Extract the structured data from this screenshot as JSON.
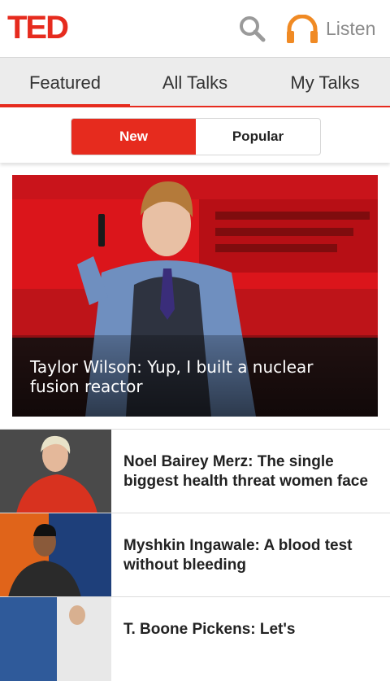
{
  "app": {
    "logo_text": "TED",
    "brand_color": "#e62b1e"
  },
  "header": {
    "search_icon": "search-icon",
    "listen_icon": "headphones-icon",
    "listen_label": "Listen"
  },
  "tabs": [
    {
      "label": "Featured",
      "active": true
    },
    {
      "label": "All Talks",
      "active": false
    },
    {
      "label": "My Talks",
      "active": false
    }
  ],
  "segmented": {
    "new_label": "New",
    "popular_label": "Popular",
    "selected": "New"
  },
  "hero": {
    "caption": "Taylor Wilson: Yup, I built a nuclear fusion reactor"
  },
  "talks": [
    {
      "title": "Noel Bairey Merz: The single biggest health threat women face"
    },
    {
      "title": "Myshkin Ingawale: A blood test without bleeding"
    },
    {
      "title": "T. Boone Pickens: Let's"
    }
  ]
}
